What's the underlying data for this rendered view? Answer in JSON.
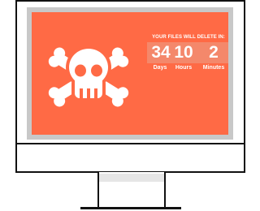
{
  "screen": {
    "background_color": "#ff6a45",
    "icon": "skull-crossbones-icon",
    "headline": "YOUR FILES WILL DELETE IN:",
    "countdown": {
      "days": "34",
      "hours": "10",
      "minutes": "2",
      "days_label": "Days",
      "hours_label": "Hours",
      "minutes_label": "Minutes"
    }
  }
}
